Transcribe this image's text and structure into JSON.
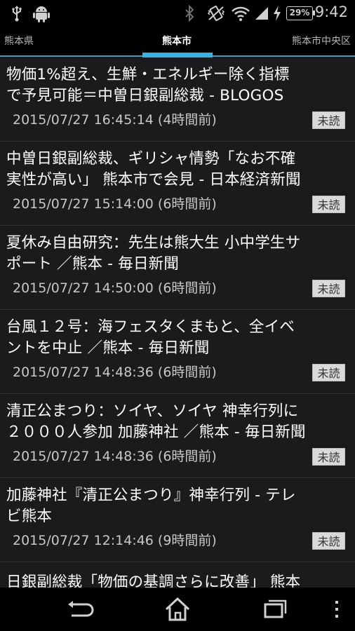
{
  "status_bar": {
    "time": "9:42",
    "battery_percent": "29%",
    "icons": [
      "usb-icon",
      "android-icon",
      "bluetooth-icon",
      "vibrate-icon",
      "wifi-icon",
      "signal-icon",
      "charging-icon"
    ]
  },
  "tabs": [
    {
      "label": "熊本県"
    },
    {
      "label": "熊本市"
    },
    {
      "label": "熊本市中央区"
    }
  ],
  "news": [
    {
      "title": "物価1%超え、生鮮・エネルギー除く指標\nで予見可能＝中曽日銀副総裁 - BLOGOS",
      "date": "2015/07/27 16:45:14 (4時間前)",
      "badge": "未読"
    },
    {
      "title": "中曽日銀副総裁、ギリシャ情勢「なお不確\n実性が高い」 熊本市で会見 - 日本経済新聞",
      "date": "2015/07/27 15:14:00 (6時間前)",
      "badge": "未読"
    },
    {
      "title": "夏休み自由研究：先生は熊大生 小中学生サ\nポート ／熊本 - 毎日新聞",
      "date": "2015/07/27 14:50:00 (6時間前)",
      "badge": "未読"
    },
    {
      "title": "台風１２号：海フェスタくまもと、全イベ\nントを中止 ／熊本 - 毎日新聞",
      "date": "2015/07/27 14:48:36 (6時間前)",
      "badge": "未読"
    },
    {
      "title": "清正公まつり：ソイヤ、ソイヤ 神幸行列に\n２０００人参加 加藤神社 ／熊本 - 毎日新聞",
      "date": "2015/07/27 14:48:36 (6時間前)",
      "badge": "未読"
    },
    {
      "title": "加藤神社『清正公まつり』神幸行列 - テレ\nビ熊本",
      "date": "2015/07/27 12:14:46 (9時間前)",
      "badge": "未読"
    },
    {
      "title": "日銀副総裁「物価の基調さらに改善」 熊本",
      "date": "",
      "badge": ""
    }
  ],
  "nav": {
    "back": "back-icon",
    "home": "home-icon",
    "recents": "recents-icon",
    "menu": "overflow-menu-icon"
  }
}
